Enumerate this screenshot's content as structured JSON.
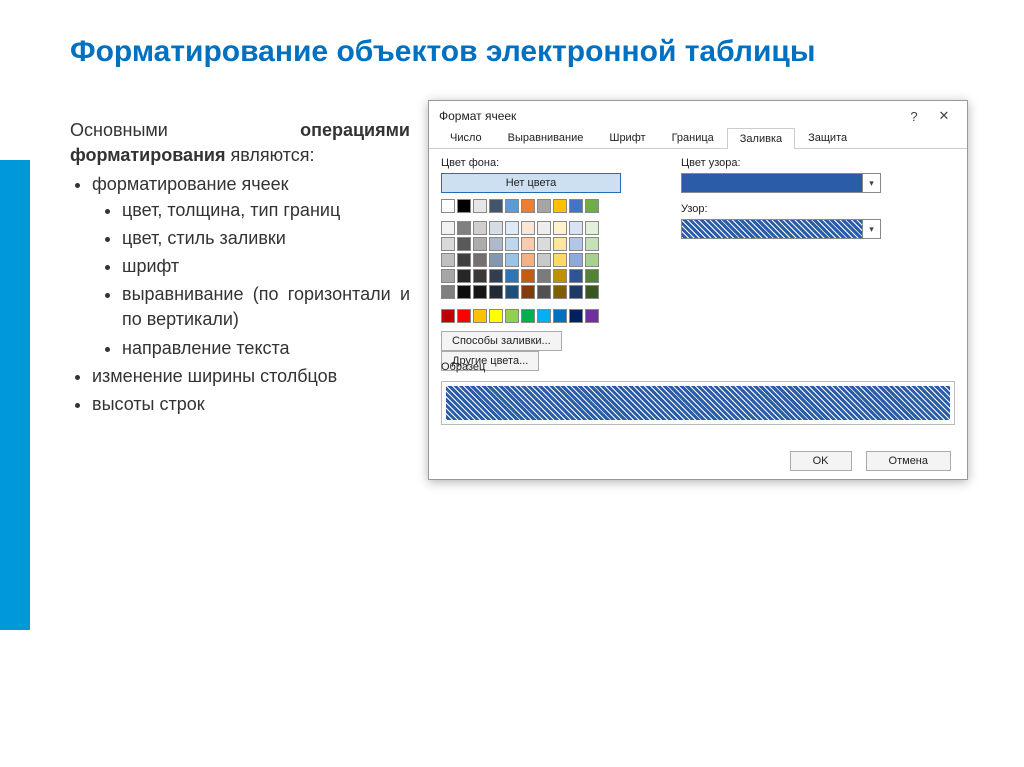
{
  "slide": {
    "title": "Форматирование объектов электронной таблицы",
    "intro_1": "Основными ",
    "intro_bold": "операциями форматирования",
    "intro_2": " являются:",
    "bullets": [
      "форматирование ячеек",
      "изменение ширины столбцов",
      "высоты строк"
    ],
    "sub_bullets": [
      "цвет, толщина, тип границ",
      "цвет, стиль заливки",
      "шрифт",
      "выравнивание (по горизонтали и по вертикали)",
      "направление текста"
    ]
  },
  "dialog": {
    "title": "Формат ячеек",
    "help": "?",
    "close": "✕",
    "tabs": [
      "Число",
      "Выравнивание",
      "Шрифт",
      "Граница",
      "Заливка",
      "Защита"
    ],
    "active_tab": "Заливка",
    "bg_label": "Цвет фона:",
    "no_color": "Нет цвета",
    "fill_button": "Способы заливки...",
    "more_colors": "Другие цвета...",
    "pattern_color_label": "Цвет узора:",
    "pattern_label": "Узор:",
    "sample_label": "Образец",
    "ok": "OK",
    "cancel": "Отмена"
  },
  "palette": {
    "theme_row": [
      "#ffffff",
      "#000000",
      "#e7e6e6",
      "#44546a",
      "#5b9bd5",
      "#ed7d31",
      "#a5a5a5",
      "#ffc000",
      "#4472c4",
      "#70ad47"
    ],
    "shade_rows": [
      [
        "#f2f2f2",
        "#7f7f7f",
        "#d0cece",
        "#d6dce5",
        "#deebf7",
        "#fbe5d6",
        "#ededed",
        "#fff2cc",
        "#d9e2f3",
        "#e2efda"
      ],
      [
        "#d9d9d9",
        "#595959",
        "#aeabab",
        "#adb9ca",
        "#bdd7ee",
        "#f8cbad",
        "#dbdbdb",
        "#ffe599",
        "#b4c6e7",
        "#c5e0b4"
      ],
      [
        "#bfbfbf",
        "#404040",
        "#757070",
        "#8497b0",
        "#9cc3e6",
        "#f4b183",
        "#c9c9c9",
        "#ffd966",
        "#8eaadb",
        "#a9d18e"
      ],
      [
        "#a6a6a6",
        "#262626",
        "#3b3838",
        "#333f50",
        "#2e75b6",
        "#c55a11",
        "#7b7b7b",
        "#bf9000",
        "#2f5597",
        "#548235"
      ],
      [
        "#7f7f7f",
        "#0d0d0d",
        "#171616",
        "#222a35",
        "#1f4e79",
        "#843c0c",
        "#525252",
        "#7f6000",
        "#1f3864",
        "#385723"
      ]
    ],
    "standard_row": [
      "#c00000",
      "#ff0000",
      "#ffc000",
      "#ffff00",
      "#92d050",
      "#00b050",
      "#00b0f0",
      "#0070c0",
      "#002060",
      "#7030a0"
    ]
  }
}
